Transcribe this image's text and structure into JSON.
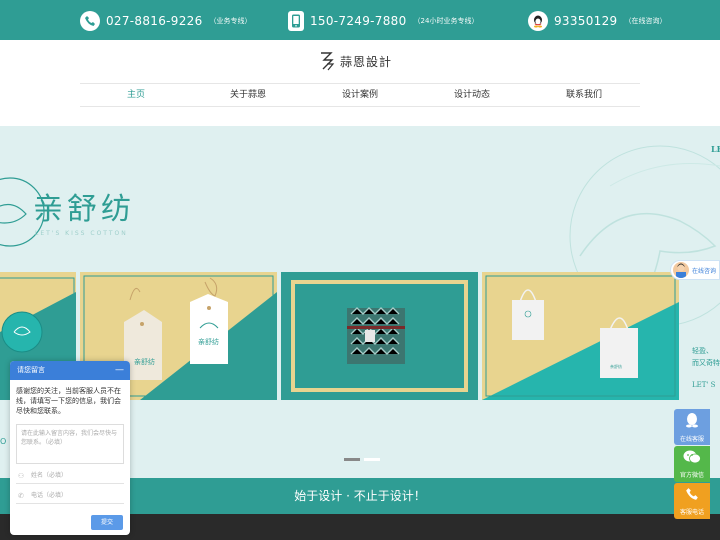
{
  "topbar": {
    "contacts": [
      {
        "number": "027-8816-9226",
        "tag": "（业务专线）",
        "icon": "phone-icon"
      },
      {
        "number": "150-7249-7880",
        "tag": "（24小时业务专线）",
        "icon": "mobile-icon"
      },
      {
        "number": "93350129",
        "tag": "（在线咨询）",
        "icon": "qq-icon"
      }
    ]
  },
  "logo": {
    "text": "蒜恩設計"
  },
  "nav": {
    "items": [
      "主页",
      "关于蒜恩",
      "设计案例",
      "设计动态",
      "联系我们"
    ],
    "active_index": 0
  },
  "banner": {
    "brand": "亲舒纺",
    "brand_en": "LET'S KISS COTTON",
    "right_top": "LE",
    "right_text": "轻盈、\n而又奇特",
    "right_let": "LET' S",
    "side_letter": "O",
    "slides_count": 2,
    "active_slide": 0
  },
  "slogan": "始于设计 · 不止于设计！",
  "message_widget": {
    "title": "请您留言",
    "minimize": "—",
    "intro": "感谢您的关注，当前客服人员不在线，请填写一下您的信息，我们会尽快和您联系。",
    "textarea_placeholder": "请在此输入留言内容，我们会尽快与您联系。（必填）",
    "name_placeholder": "姓名（必填）",
    "phone_placeholder": "电话（必填）",
    "submit": "提交"
  },
  "consult_tab": {
    "label": "在线咨询"
  },
  "right_float": [
    {
      "label": "在线客服",
      "icon": "qq-penguin-icon",
      "color": "#6d9fe0"
    },
    {
      "label": "官方微信",
      "icon": "wechat-icon",
      "color": "#54b84a"
    },
    {
      "label": "客服电话",
      "icon": "phone-icon",
      "color": "#f0a020"
    }
  ],
  "colors": {
    "brand_teal": "#2f9d94",
    "banner_bg": "#dff0f0",
    "widget_blue": "#3b7fd9",
    "sand": "#e8d48f"
  }
}
